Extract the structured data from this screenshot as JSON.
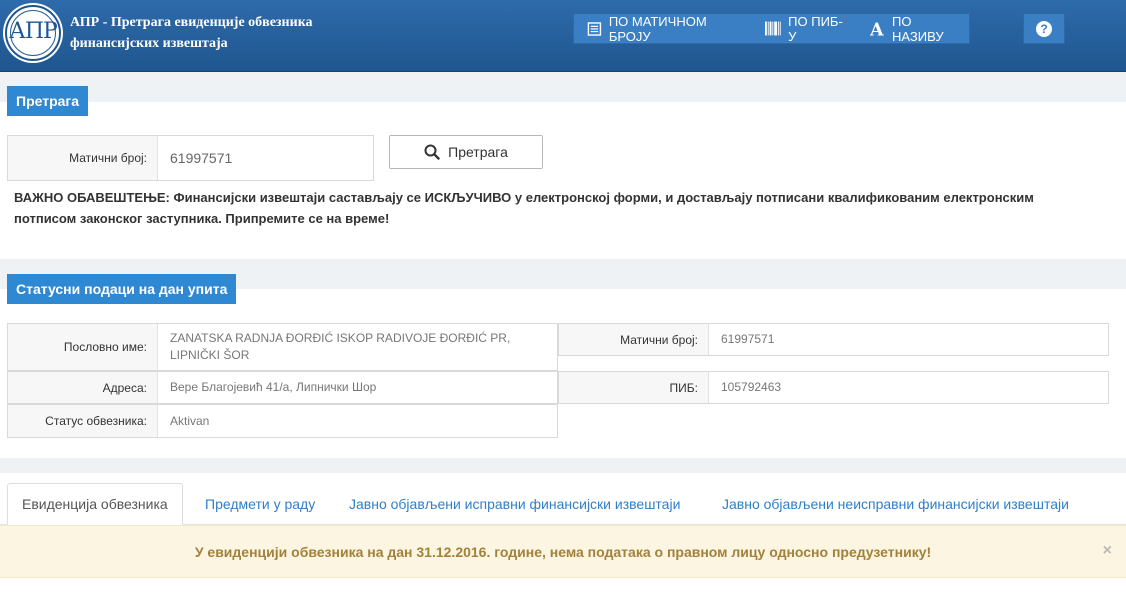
{
  "header": {
    "logo_text": "АПР",
    "app_title": "АПР - Претрага евиденције обвезника финансијских извештаја",
    "nav": [
      {
        "label": "ПО МАТИЧНОМ БРОЈУ",
        "icon": "document-list-icon"
      },
      {
        "label": "ПО ПИБ-У",
        "icon": "barcode-icon"
      },
      {
        "label": "ПО НАЗИВУ",
        "icon": "letter-a-icon"
      }
    ],
    "help_label": "?"
  },
  "search_section": {
    "title": "Претрага",
    "field_label": "Матични број:",
    "field_value": "61997571",
    "button_label": "Претрага",
    "notice": "ВАЖНО ОБАВЕШТЕЊЕ: Финансијски извештаји састављају се ИСКЉУЧИВО у електронској форми, и достављају потписани квалификованим електронским потписом законског заступника. Припремите се на време!"
  },
  "status_section": {
    "title": "Статусни подаци на дан упита",
    "fields": {
      "business_name_label": "Пословно име:",
      "business_name_value": "ZANATSKA RADNJA ĐORĐIĆ ISKOP RADIVOJE ĐORĐIĆ PR, LIPNIČKI ŠOR",
      "address_label": "Адреса:",
      "address_value": "Вере Благојевић 41/а, Липнички Шор",
      "status_label": "Статус обвезника:",
      "status_value": "Aktivan",
      "reg_no_label": "Матични број:",
      "reg_no_value": "61997571",
      "pib_label": "ПИБ:",
      "pib_value": "105792463"
    }
  },
  "tabs": [
    {
      "label": "Евиденција обвезника",
      "active": true
    },
    {
      "label": "Предмети у раду",
      "active": false
    },
    {
      "label": "Јавно објављени исправни финансијски извештаји",
      "active": false
    },
    {
      "label": "Јавно објављени неисправни финансијски извештаји",
      "active": false
    }
  ],
  "alert": {
    "message": "У евиденцији обвезника на дан 31.12.2016. године, нема података о правном лицу односно предузетнику!",
    "close": "×"
  }
}
